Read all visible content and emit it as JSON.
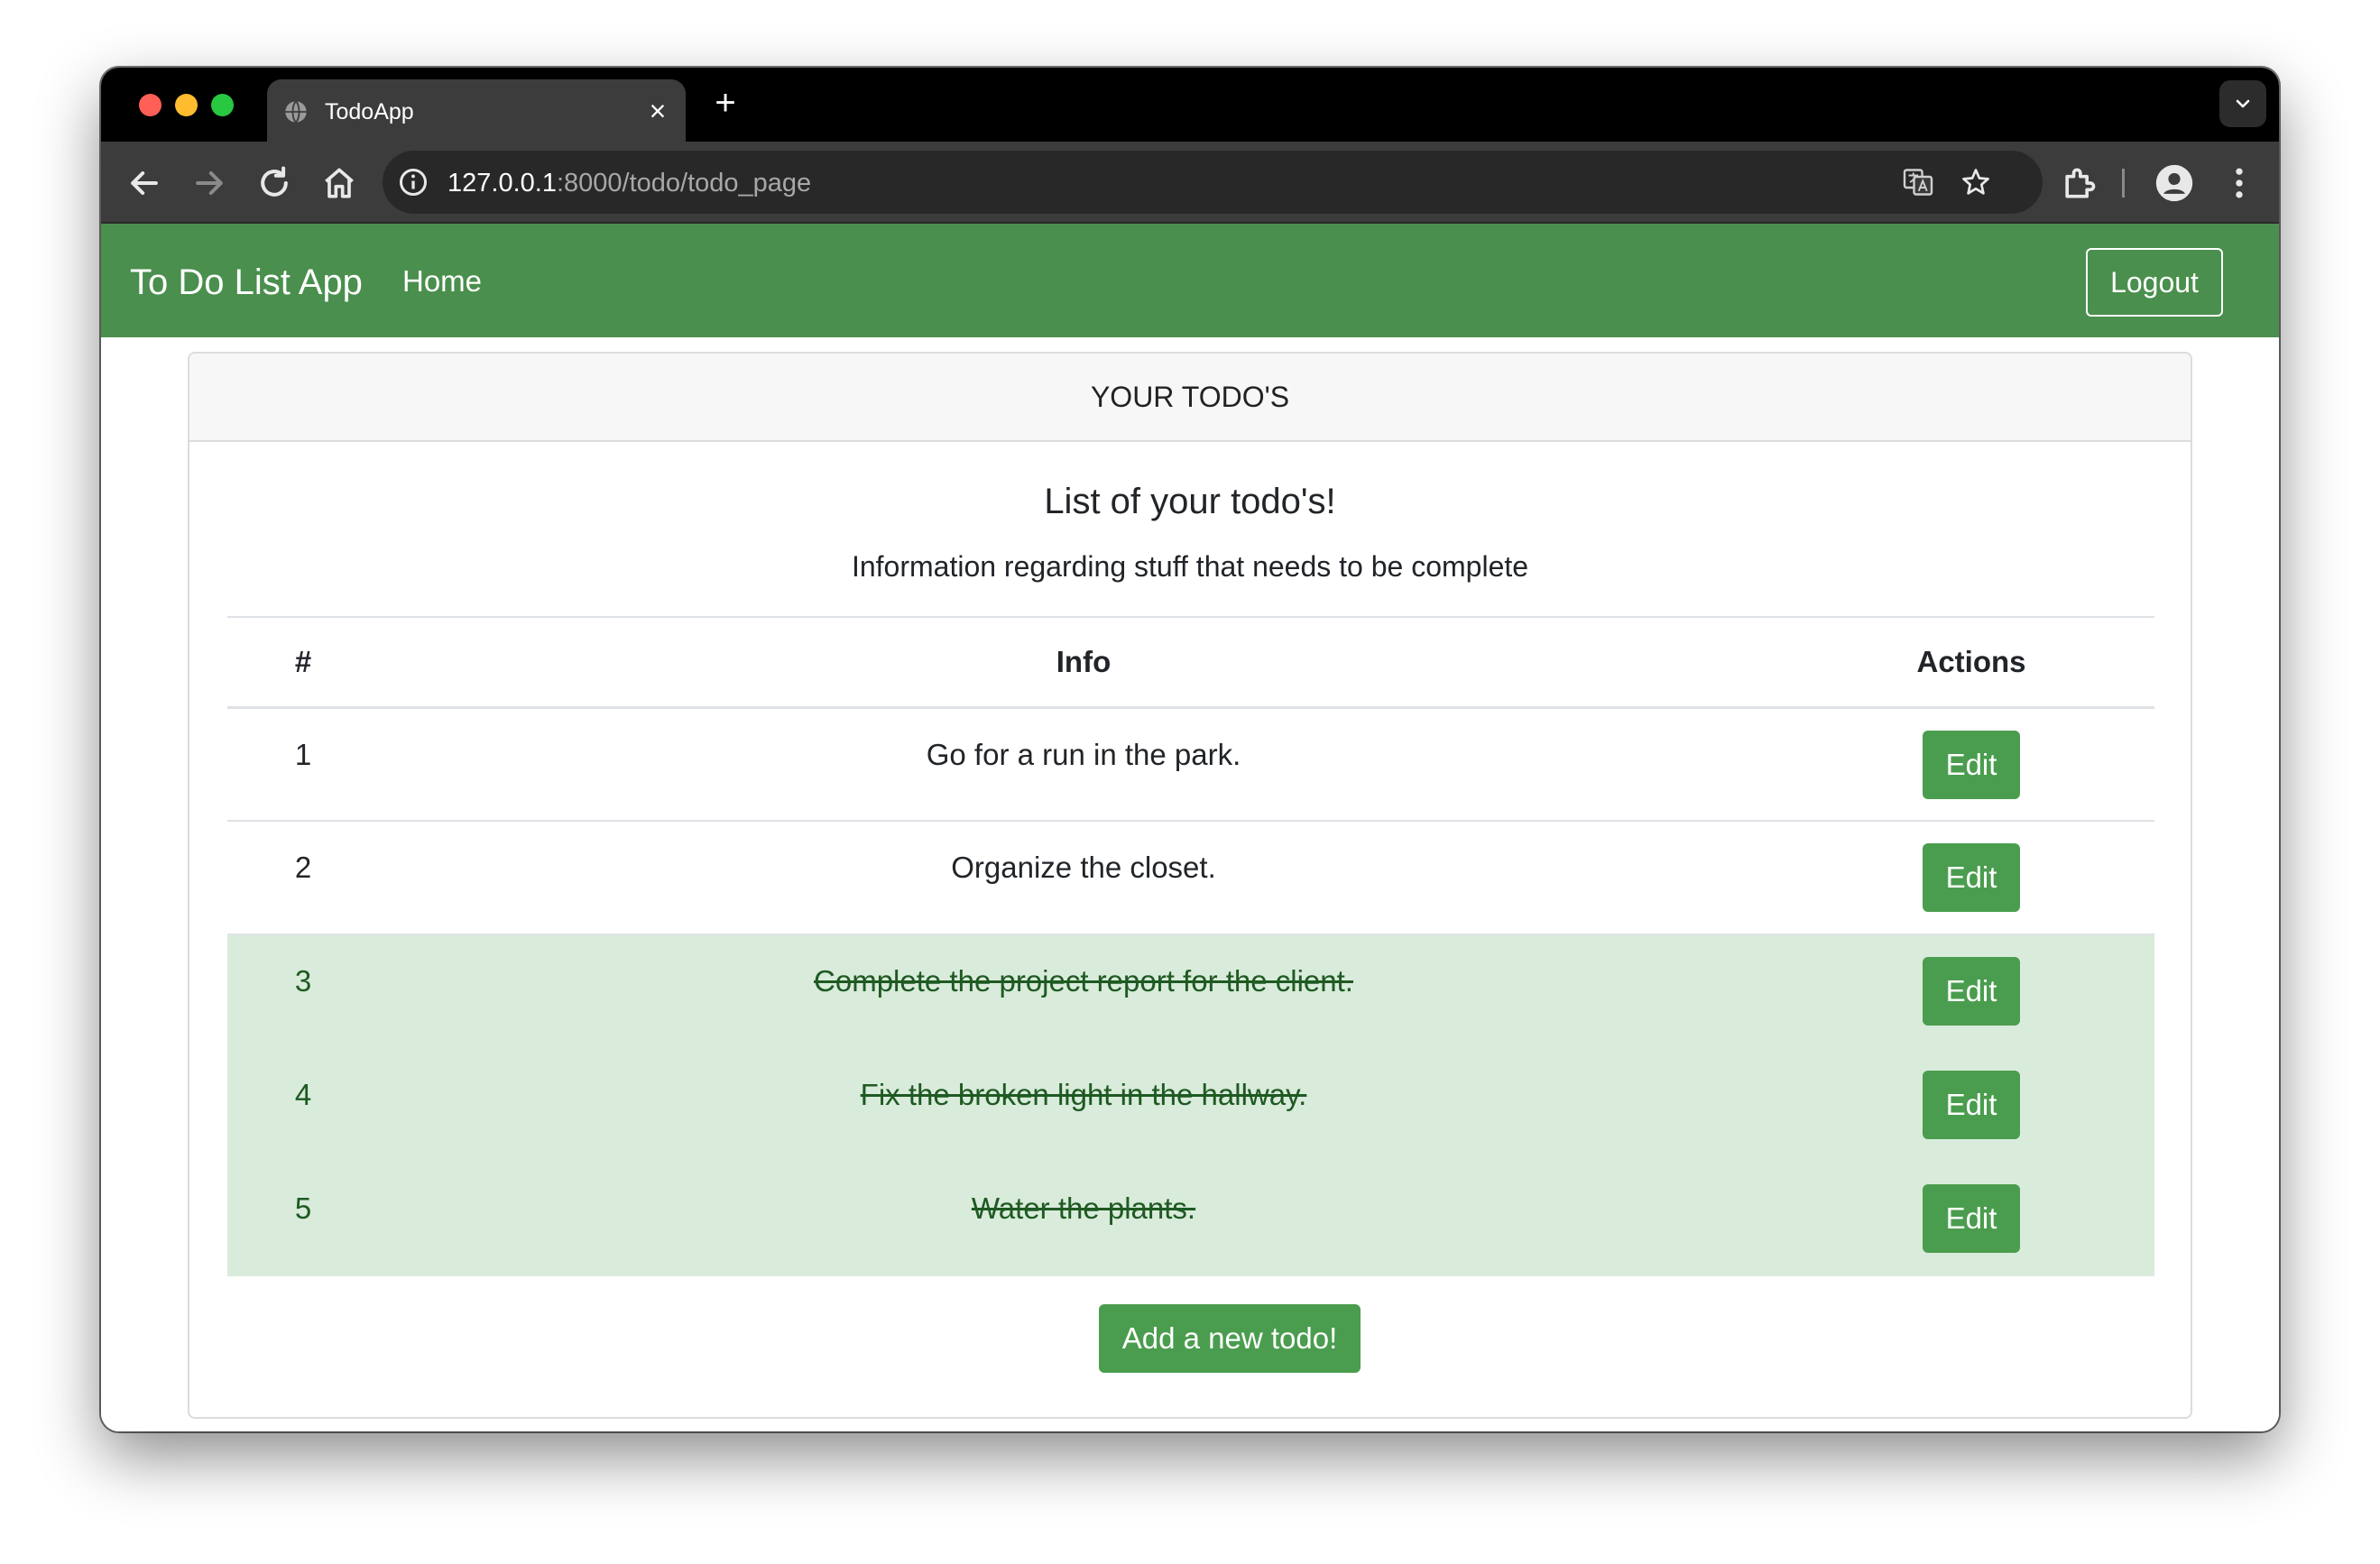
{
  "browser": {
    "tab_title": "TodoApp",
    "tab_close": "×",
    "new_tab": "+",
    "url_host": "127.0.0.1",
    "url_path": ":8000/todo/todo_page"
  },
  "navbar": {
    "brand": "To Do List App",
    "home_label": "Home",
    "logout_label": "Logout"
  },
  "card": {
    "header": "YOUR TODO'S",
    "title": "List of your todo's!",
    "text": "Information regarding stuff that needs to be complete"
  },
  "table": {
    "headers": [
      "#",
      "Info",
      "Actions"
    ],
    "rows": [
      {
        "num": "1",
        "info": "Go for a run in the park.",
        "action": "Edit",
        "complete": false
      },
      {
        "num": "2",
        "info": "Organize the closet.",
        "action": "Edit",
        "complete": false
      },
      {
        "num": "3",
        "info": "Complete the project report for the client.",
        "action": "Edit",
        "complete": true
      },
      {
        "num": "4",
        "info": "Fix the broken light in the hallway.",
        "action": "Edit",
        "complete": true
      },
      {
        "num": "5",
        "info": "Water the plants.",
        "action": "Edit",
        "complete": true
      }
    ]
  },
  "add_button_label": "Add a new todo!",
  "colors": {
    "navbar": "#4a8f4d",
    "button": "#4a9d4e",
    "complete_row": "#d9ebdb"
  }
}
